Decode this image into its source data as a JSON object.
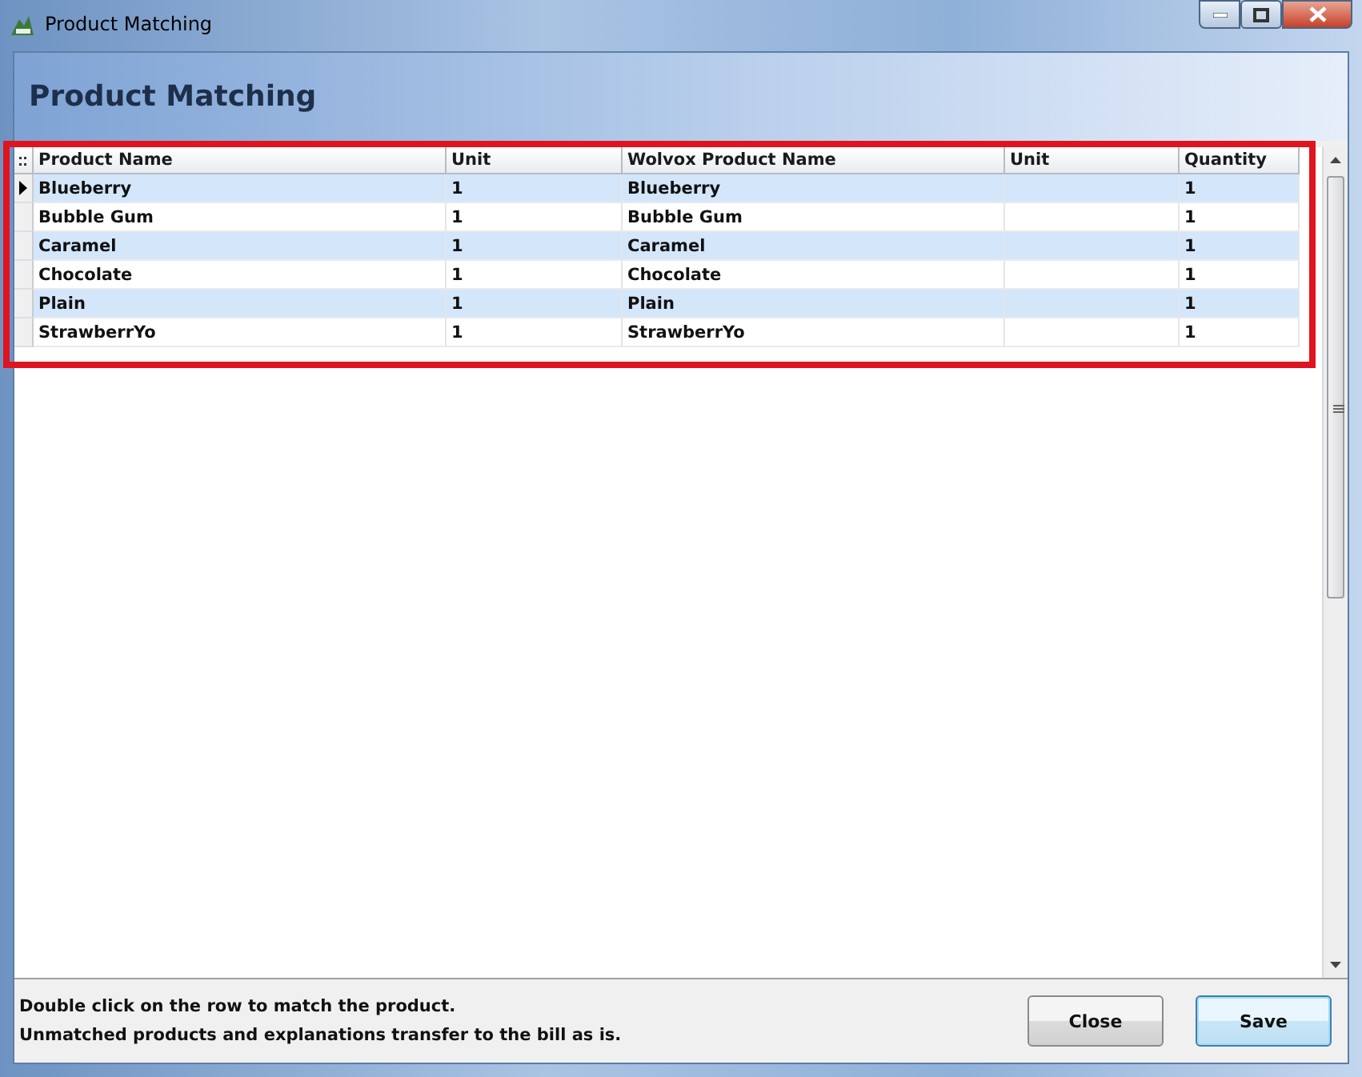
{
  "window": {
    "title": "Product Matching"
  },
  "header": {
    "title": "Product Matching"
  },
  "table": {
    "columns": [
      "Product Name",
      "Unit",
      "Wolvox Product Name",
      "Unit",
      "Quantity"
    ],
    "rows": [
      {
        "cells": [
          "Blueberry",
          "1",
          "Blueberry",
          "",
          "1"
        ],
        "selected": true
      },
      {
        "cells": [
          "Bubble Gum",
          "1",
          "Bubble Gum",
          "",
          "1"
        ],
        "selected": false
      },
      {
        "cells": [
          "Caramel",
          "1",
          "Caramel",
          "",
          "1"
        ],
        "selected": false
      },
      {
        "cells": [
          "Chocolate",
          "1",
          "Chocolate",
          "",
          "1"
        ],
        "selected": false
      },
      {
        "cells": [
          "Plain",
          "1",
          "Plain",
          "",
          "1"
        ],
        "selected": false
      },
      {
        "cells": [
          "StrawberrYo",
          "1",
          "StrawberrYo",
          "",
          "1"
        ],
        "selected": false
      }
    ]
  },
  "footer": {
    "notes": [
      "Double click on the row to match the product.",
      "Unmatched products and explanations transfer to the bill as is."
    ],
    "buttons": [
      {
        "label": "Close",
        "default": false
      },
      {
        "label": "Save",
        "default": true
      }
    ]
  }
}
